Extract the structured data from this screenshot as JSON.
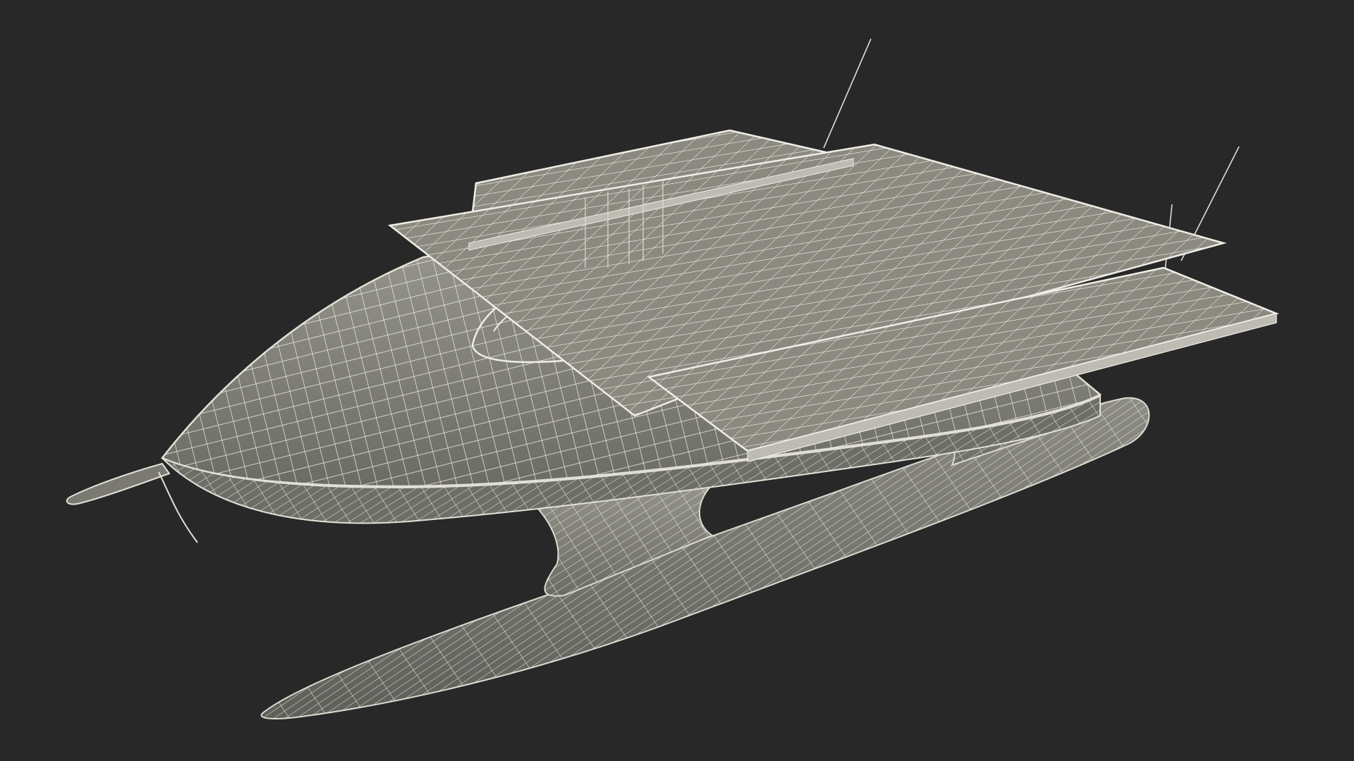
{
  "scene": {
    "subject": "solar-catamaran-wireframe-model",
    "background_color": "#282828",
    "surface_color": "#8f8f86",
    "surface_shadow_color": "#6f6f68",
    "panel_color": "#8c8a80",
    "wire_color": "#efeee6",
    "edge_color": "#d8d6cc"
  }
}
